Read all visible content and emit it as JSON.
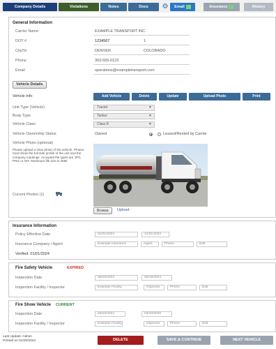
{
  "tabs": [
    {
      "label": "Company Details",
      "color": "#1b3f7a"
    },
    {
      "label": "Violations",
      "color": "#3d5e2a"
    },
    {
      "label": "Notes",
      "color": "#3b6b96"
    },
    {
      "label": "Docs",
      "color": "#3b6b96"
    },
    {
      "label": "Email",
      "color": "#2a78c4"
    },
    {
      "label": "Insurance",
      "color": "#9aa4b0"
    },
    {
      "label": "History",
      "color": "#b3bac3"
    }
  ],
  "general": {
    "title": "General Information",
    "fields": [
      {
        "label": "Carrier Name",
        "value": "EXAMPLE TRANSPORT INC."
      },
      {
        "label": "DOT #",
        "value": "1234567",
        "extra": "1"
      },
      {
        "label": "City/St",
        "value": "DENVER",
        "extra": "COLORADO"
      },
      {
        "label": "Phone",
        "value": "303-555-0123"
      },
      {
        "label": "Email",
        "value": "operations@exampletransport.com"
      }
    ]
  },
  "vehicle": {
    "button": "Vehicle Details",
    "row_label": "Vehicle Info",
    "actions": [
      "Add Vehicle",
      "Delete",
      "Update",
      "Upload Photo",
      "Print"
    ],
    "selects": [
      {
        "label": "Unit Type (Vehicle)",
        "value": "Tractor"
      },
      {
        "label": "Body Type",
        "value": "Tanker"
      },
      {
        "label": "Vehicle Class",
        "value": "Class 8"
      }
    ],
    "radio_label": "Vehicle Ownership Status",
    "radio_options": [
      "Owned",
      "Leased/Rented by Carrier"
    ],
    "photo_label": "Vehicle Photo (optional)",
    "instructions": "Please upload a clear photo of the vehicle. Photos must show the full side profile of the unit and the company markings. Accepted file types are JPG, PNG or GIF. Maximum file size is 2MB.",
    "photo_count_label": "Current Photos (1)",
    "browse": "Browse",
    "browse_link": "Upload"
  },
  "insurance": {
    "title": "Insurance Information",
    "title_status": "",
    "rows": [
      {
        "label": "Policy Effective Date",
        "inputs": [
          "01/01/2024",
          "12/31/2024"
        ]
      },
      {
        "label": "Insurance Company / Agent",
        "inputs": [
          "Example Insurance",
          "Agent",
          "Phone",
          "Edit"
        ]
      }
    ],
    "last_label": "Verified: 01/01/2024"
  },
  "fire": {
    "title": "Fire Safety Vehicle",
    "status": "EXPIRED",
    "status_color": "#c0392b",
    "rows": [
      {
        "label": "Inspection Date",
        "inputs": [
          "06/15/2023",
          "06/15/2024"
        ]
      },
      {
        "label": "Inspection Facility / Inspector",
        "inputs": [
          "Example Facility",
          "Inspector",
          "Phone",
          "Edit"
        ]
      }
    ]
  },
  "dot": {
    "title": "Fire Show Vehicle",
    "status": "CURRENT",
    "status_color": "#2e8b2e",
    "rows": [
      {
        "label": "Inspection Date",
        "inputs": [
          "03/10/2024",
          "03/10/2025"
        ]
      },
      {
        "label": "Inspection Facility / Inspector",
        "inputs": [
          "Example Facility",
          "Inspector",
          "Phone",
          "Edit"
        ]
      }
    ]
  },
  "footer": {
    "info_line1": "Last Update: Admin",
    "info_line2": "Printed on 01/20/2024",
    "delete": "DELETE",
    "save": "SAVE & CONTINUE",
    "next": "NEXT VEHICLE"
  }
}
